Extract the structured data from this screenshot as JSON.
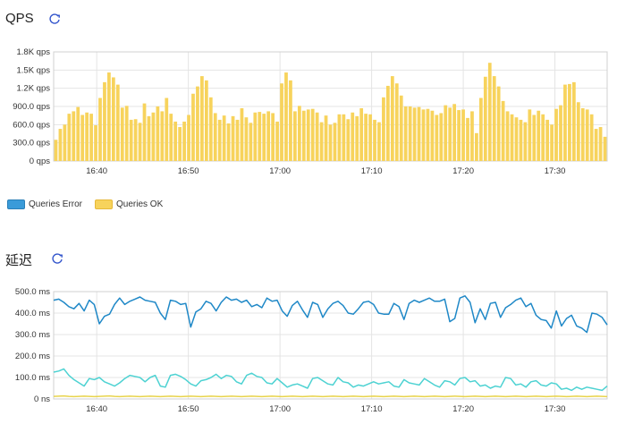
{
  "qps_panel": {
    "title": "QPS",
    "refresh_icon": "refresh-icon",
    "legend": [
      {
        "label": "Queries Error",
        "color": "#3a9bd9",
        "border": "#2a7fb8"
      },
      {
        "label": "Queries OK",
        "color": "#f7d35c",
        "border": "#e6b93a"
      }
    ]
  },
  "latency_panel": {
    "title": "延迟",
    "refresh_icon": "refresh-icon"
  },
  "chart_data": [
    {
      "type": "bar",
      "title": "QPS",
      "ylim": [
        0,
        1800
      ],
      "y_ticks": [
        {
          "value": 0,
          "label": "0 qps"
        },
        {
          "value": 300,
          "label": "300.0 qps"
        },
        {
          "value": 600,
          "label": "600.0 qps"
        },
        {
          "value": 900,
          "label": "900.0 qps"
        },
        {
          "value": 1200,
          "label": "1.2K qps"
        },
        {
          "value": 1500,
          "label": "1.5K qps"
        },
        {
          "value": 1800,
          "label": "1.8K qps"
        }
      ],
      "x_ticks": [
        "16:40",
        "16:50",
        "17:00",
        "17:10",
        "17:20",
        "17:30"
      ],
      "x_tick_start_minute": 40,
      "x_range_minutes": [
        35.3,
        95.7
      ],
      "series": [
        {
          "name": "Queries OK",
          "color": "#f7d35c",
          "values": [
            350,
            530,
            600,
            780,
            820,
            890,
            760,
            800,
            780,
            590,
            1040,
            1300,
            1460,
            1380,
            1260,
            880,
            910,
            680,
            690,
            630,
            950,
            740,
            800,
            900,
            820,
            1040,
            780,
            650,
            560,
            650,
            760,
            1110,
            1230,
            1400,
            1330,
            1050,
            790,
            680,
            750,
            620,
            740,
            680,
            870,
            720,
            630,
            800,
            810,
            780,
            820,
            790,
            650,
            1280,
            1460,
            1330,
            820,
            910,
            830,
            850,
            860,
            800,
            640,
            750,
            600,
            630,
            770,
            770,
            690,
            800,
            740,
            870,
            780,
            770,
            680,
            640,
            1050,
            1240,
            1400,
            1280,
            1080,
            900,
            900,
            880,
            890,
            850,
            860,
            830,
            760,
            790,
            920,
            880,
            940,
            840,
            850,
            710,
            820,
            460,
            1040,
            1390,
            1620,
            1400,
            1230,
            990,
            820,
            770,
            720,
            680,
            640,
            850,
            760,
            830,
            770,
            680,
            600,
            860,
            920,
            1260,
            1270,
            1300,
            970,
            870,
            850,
            770,
            530,
            560,
            400
          ]
        }
      ]
    },
    {
      "type": "line",
      "title": "延迟",
      "ylim": [
        0,
        500
      ],
      "y_ticks": [
        {
          "value": 0,
          "label": "0 ns"
        },
        {
          "value": 100,
          "label": "100.0 ms"
        },
        {
          "value": 200,
          "label": "200.0 ms"
        },
        {
          "value": 300,
          "label": "300.0 ms"
        },
        {
          "value": 400,
          "label": "400.0 ms"
        },
        {
          "value": 500,
          "label": "500.0 ms"
        }
      ],
      "x_ticks": [
        "16:40",
        "16:50",
        "17:00",
        "17:10",
        "17:20",
        "17:30"
      ],
      "x_tick_start_minute": 40,
      "x_range_minutes": [
        35.3,
        95.7
      ],
      "series": [
        {
          "color": "#1f88c7",
          "values": [
            460,
            465,
            450,
            430,
            420,
            445,
            410,
            460,
            440,
            350,
            385,
            395,
            440,
            470,
            440,
            455,
            465,
            475,
            460,
            455,
            450,
            400,
            370,
            460,
            455,
            440,
            445,
            335,
            405,
            420,
            455,
            445,
            410,
            450,
            475,
            460,
            465,
            450,
            460,
            430,
            440,
            425,
            470,
            455,
            460,
            410,
            385,
            435,
            455,
            415,
            380,
            450,
            440,
            380,
            420,
            445,
            455,
            435,
            400,
            395,
            420,
            450,
            455,
            440,
            400,
            395,
            395,
            445,
            430,
            370,
            445,
            460,
            450,
            460,
            470,
            455,
            455,
            465,
            360,
            375,
            470,
            480,
            450,
            355,
            420,
            370,
            445,
            450,
            380,
            425,
            440,
            460,
            470,
            430,
            445,
            390,
            370,
            365,
            330,
            410,
            340,
            375,
            390,
            340,
            330,
            310,
            400,
            395,
            380,
            345
          ]
        },
        {
          "color": "#4dd2d2",
          "values": [
            125,
            130,
            140,
            110,
            90,
            75,
            60,
            95,
            90,
            100,
            80,
            70,
            60,
            75,
            95,
            110,
            105,
            100,
            80,
            100,
            110,
            60,
            55,
            110,
            115,
            105,
            90,
            70,
            60,
            85,
            90,
            100,
            115,
            95,
            110,
            105,
            80,
            70,
            110,
            120,
            105,
            100,
            75,
            70,
            95,
            75,
            55,
            65,
            70,
            60,
            50,
            95,
            100,
            85,
            70,
            65,
            100,
            80,
            75,
            55,
            65,
            60,
            70,
            80,
            70,
            75,
            80,
            60,
            55,
            90,
            75,
            70,
            65,
            95,
            80,
            65,
            55,
            85,
            80,
            65,
            95,
            100,
            80,
            85,
            60,
            65,
            50,
            60,
            55,
            100,
            95,
            65,
            70,
            55,
            80,
            85,
            65,
            60,
            75,
            70,
            45,
            50,
            40,
            55,
            45,
            55,
            50,
            45,
            40,
            60
          ]
        },
        {
          "color": "#e8d44d",
          "values": [
            12,
            13,
            14,
            12,
            11,
            12,
            13,
            12,
            11,
            12,
            13,
            14,
            12,
            11,
            12,
            13,
            12,
            11,
            12,
            13,
            12,
            11,
            12,
            13,
            12,
            11,
            12,
            13,
            12,
            11,
            12,
            13,
            12,
            11,
            12,
            13,
            12,
            11,
            12,
            13,
            12,
            11,
            12,
            13,
            12,
            11,
            12,
            13,
            12,
            11,
            12,
            13,
            12,
            11,
            12,
            13,
            12,
            11,
            12,
            13,
            12,
            11,
            12,
            13,
            12,
            11,
            12,
            13,
            12,
            11,
            12,
            13,
            12,
            11,
            12,
            13,
            12,
            11,
            12,
            13,
            12,
            11,
            12,
            13,
            12,
            11,
            12,
            13,
            12,
            11,
            12,
            13,
            12,
            11,
            12,
            13,
            12,
            11,
            12,
            13,
            12,
            11,
            12,
            13,
            12,
            11,
            12,
            13,
            12,
            11
          ]
        }
      ]
    }
  ]
}
